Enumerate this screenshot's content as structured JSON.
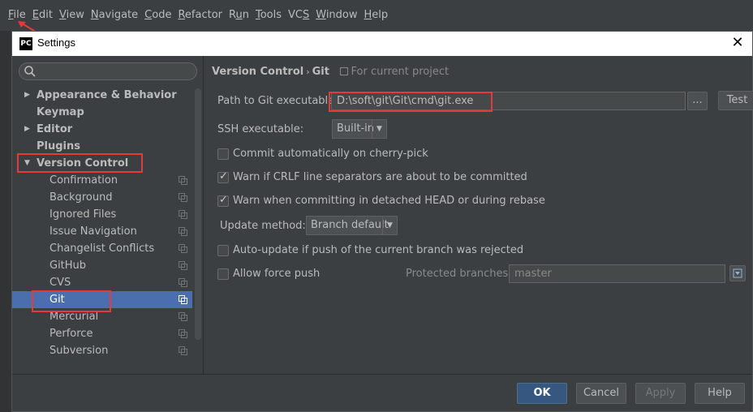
{
  "menubar": {
    "items": [
      {
        "pre": "",
        "u": "F",
        "post": "ile"
      },
      {
        "pre": "",
        "u": "E",
        "post": "dit"
      },
      {
        "pre": "",
        "u": "V",
        "post": "iew"
      },
      {
        "pre": "",
        "u": "N",
        "post": "avigate"
      },
      {
        "pre": "",
        "u": "C",
        "post": "ode"
      },
      {
        "pre": "",
        "u": "R",
        "post": "efactor"
      },
      {
        "pre": "R",
        "u": "u",
        "post": "n"
      },
      {
        "pre": "",
        "u": "T",
        "post": "ools"
      },
      {
        "pre": "VC",
        "u": "S",
        "post": ""
      },
      {
        "pre": "",
        "u": "W",
        "post": "indow"
      },
      {
        "pre": "",
        "u": "H",
        "post": "elp"
      }
    ]
  },
  "dialog": {
    "logo": "PC",
    "title": "Settings",
    "close": "✕"
  },
  "tree": {
    "top_items": {
      "appearance": "Appearance & Behavior",
      "keymap": "Keymap",
      "editor": "Editor",
      "plugins": "Plugins",
      "version_control": "Version Control"
    },
    "vc_children": [
      "Confirmation",
      "Background",
      "Ignored Files",
      "Issue Navigation",
      "Changelist Conflicts",
      "GitHub",
      "CVS",
      "Git",
      "Mercurial",
      "Perforce",
      "Subversion"
    ],
    "selected": "Git"
  },
  "breadcrumb": {
    "section": "Version Control",
    "separator": "›",
    "page": "Git",
    "scope": "For current project"
  },
  "git": {
    "path_label": "Path to Git executable:",
    "path_value": "D:\\soft\\git\\Git\\cmd\\git.exe",
    "browse_label": "...",
    "test_label": "Test",
    "ssh_label": "SSH executable:",
    "ssh_value": "Built-in",
    "cb_cherry_pick": "Commit automatically on cherry-pick",
    "cb_crlf": "Warn if CRLF line separators are about to be committed",
    "cb_detached": "Warn when committing in detached HEAD or during rebase",
    "update_label": "Update method:",
    "update_value": "Branch default",
    "cb_autoupdate": "Auto-update if push of the current branch was rejected",
    "cb_force_push": "Allow force push",
    "protected_label": "Protected branches:",
    "protected_value": "master"
  },
  "checkbox_state": {
    "cherry_pick": false,
    "crlf": true,
    "detached": true,
    "autoupdate": false,
    "force_push": false
  },
  "footer": {
    "ok": "OK",
    "cancel": "Cancel",
    "apply": "Apply",
    "help": "Help"
  },
  "colors": {
    "selection": "#4b6eaf",
    "highlight_annotation": "#e8393a",
    "ok_button": "#365880"
  }
}
